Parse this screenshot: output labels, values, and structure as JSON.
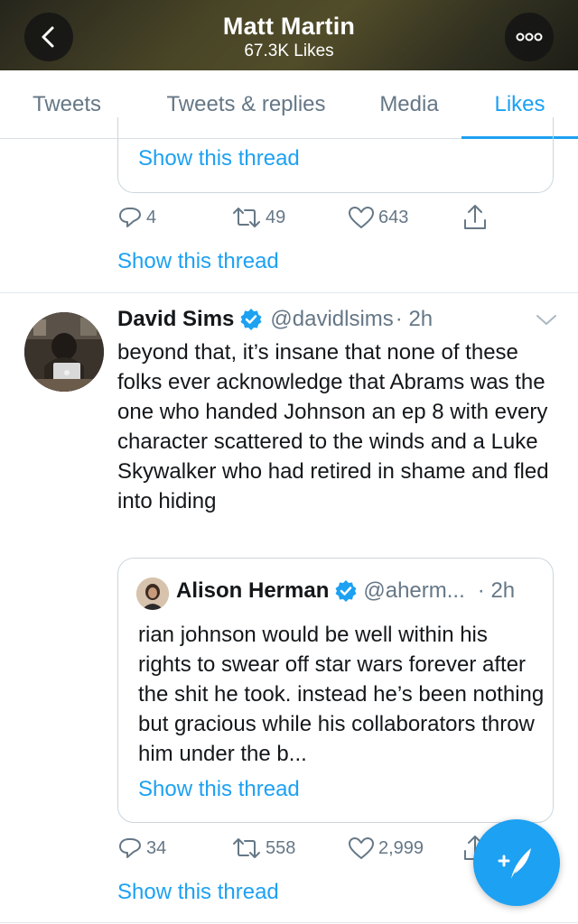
{
  "header": {
    "title": "Matt Martin",
    "subtitle": "67.3K Likes"
  },
  "tabs": [
    {
      "label": "Tweets"
    },
    {
      "label": "Tweets & replies"
    },
    {
      "label": "Media"
    },
    {
      "label": "Likes",
      "active": true
    }
  ],
  "prev_tweet": {
    "quote_show_thread": "Show this thread",
    "replies": "4",
    "retweets": "49",
    "likes": "643",
    "show_thread": "Show this thread"
  },
  "tweet": {
    "name": "David Sims",
    "handle": "@davidlsims",
    "time": "· 2h",
    "text": "beyond that, it’s insane that none of these folks ever acknowledge that Abrams was the one who handed Johnson an ep 8 with every character scattered to the winds and a Luke Skywalker who had retired in shame and fled into hiding",
    "quote": {
      "name": "Alison Herman",
      "handle": "@aherm...",
      "time": "· 2h",
      "text": "rian johnson would be well within his rights to swear off star wars forever after the shit he took. instead he’s been nothing but gracious while his collaborators throw him under the b...",
      "show_thread": "Show this thread"
    },
    "replies": "34",
    "retweets": "558",
    "likes": "2,999",
    "show_thread": "Show this thread"
  },
  "colors": {
    "accent": "#1da1f2",
    "muted": "#657786",
    "text": "#14171a"
  },
  "icons": [
    "back-arrow-icon",
    "more-icon",
    "reply-icon",
    "retweet-icon",
    "like-icon",
    "share-icon",
    "verified-icon",
    "chevron-down-icon",
    "compose-icon"
  ]
}
